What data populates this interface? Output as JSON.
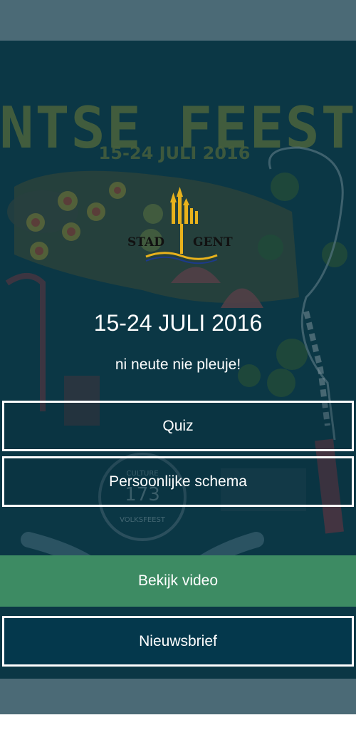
{
  "header": {},
  "background": {
    "headline": "GENTSE FEESTEN",
    "subline": "15-24 JULI 2016",
    "badge_top": "CULTURE",
    "badge_number": "173",
    "badge_bottom": "VOLKSFEEST"
  },
  "logo": {
    "text_left": "STAD",
    "text_right": "GENT",
    "color": "#e8b21c"
  },
  "main": {
    "date": "15-24 JULI 2016",
    "slogan": "ni neute nie pleuje!"
  },
  "buttons": {
    "quiz": "Quiz",
    "schema": "Persoonlijke schema",
    "video": "Bekijk video",
    "newsletter": "Nieuwsbrief"
  },
  "colors": {
    "bar": "#4b6a76",
    "video_button": "#3d8b63",
    "newsletter_button": "#04384c"
  }
}
